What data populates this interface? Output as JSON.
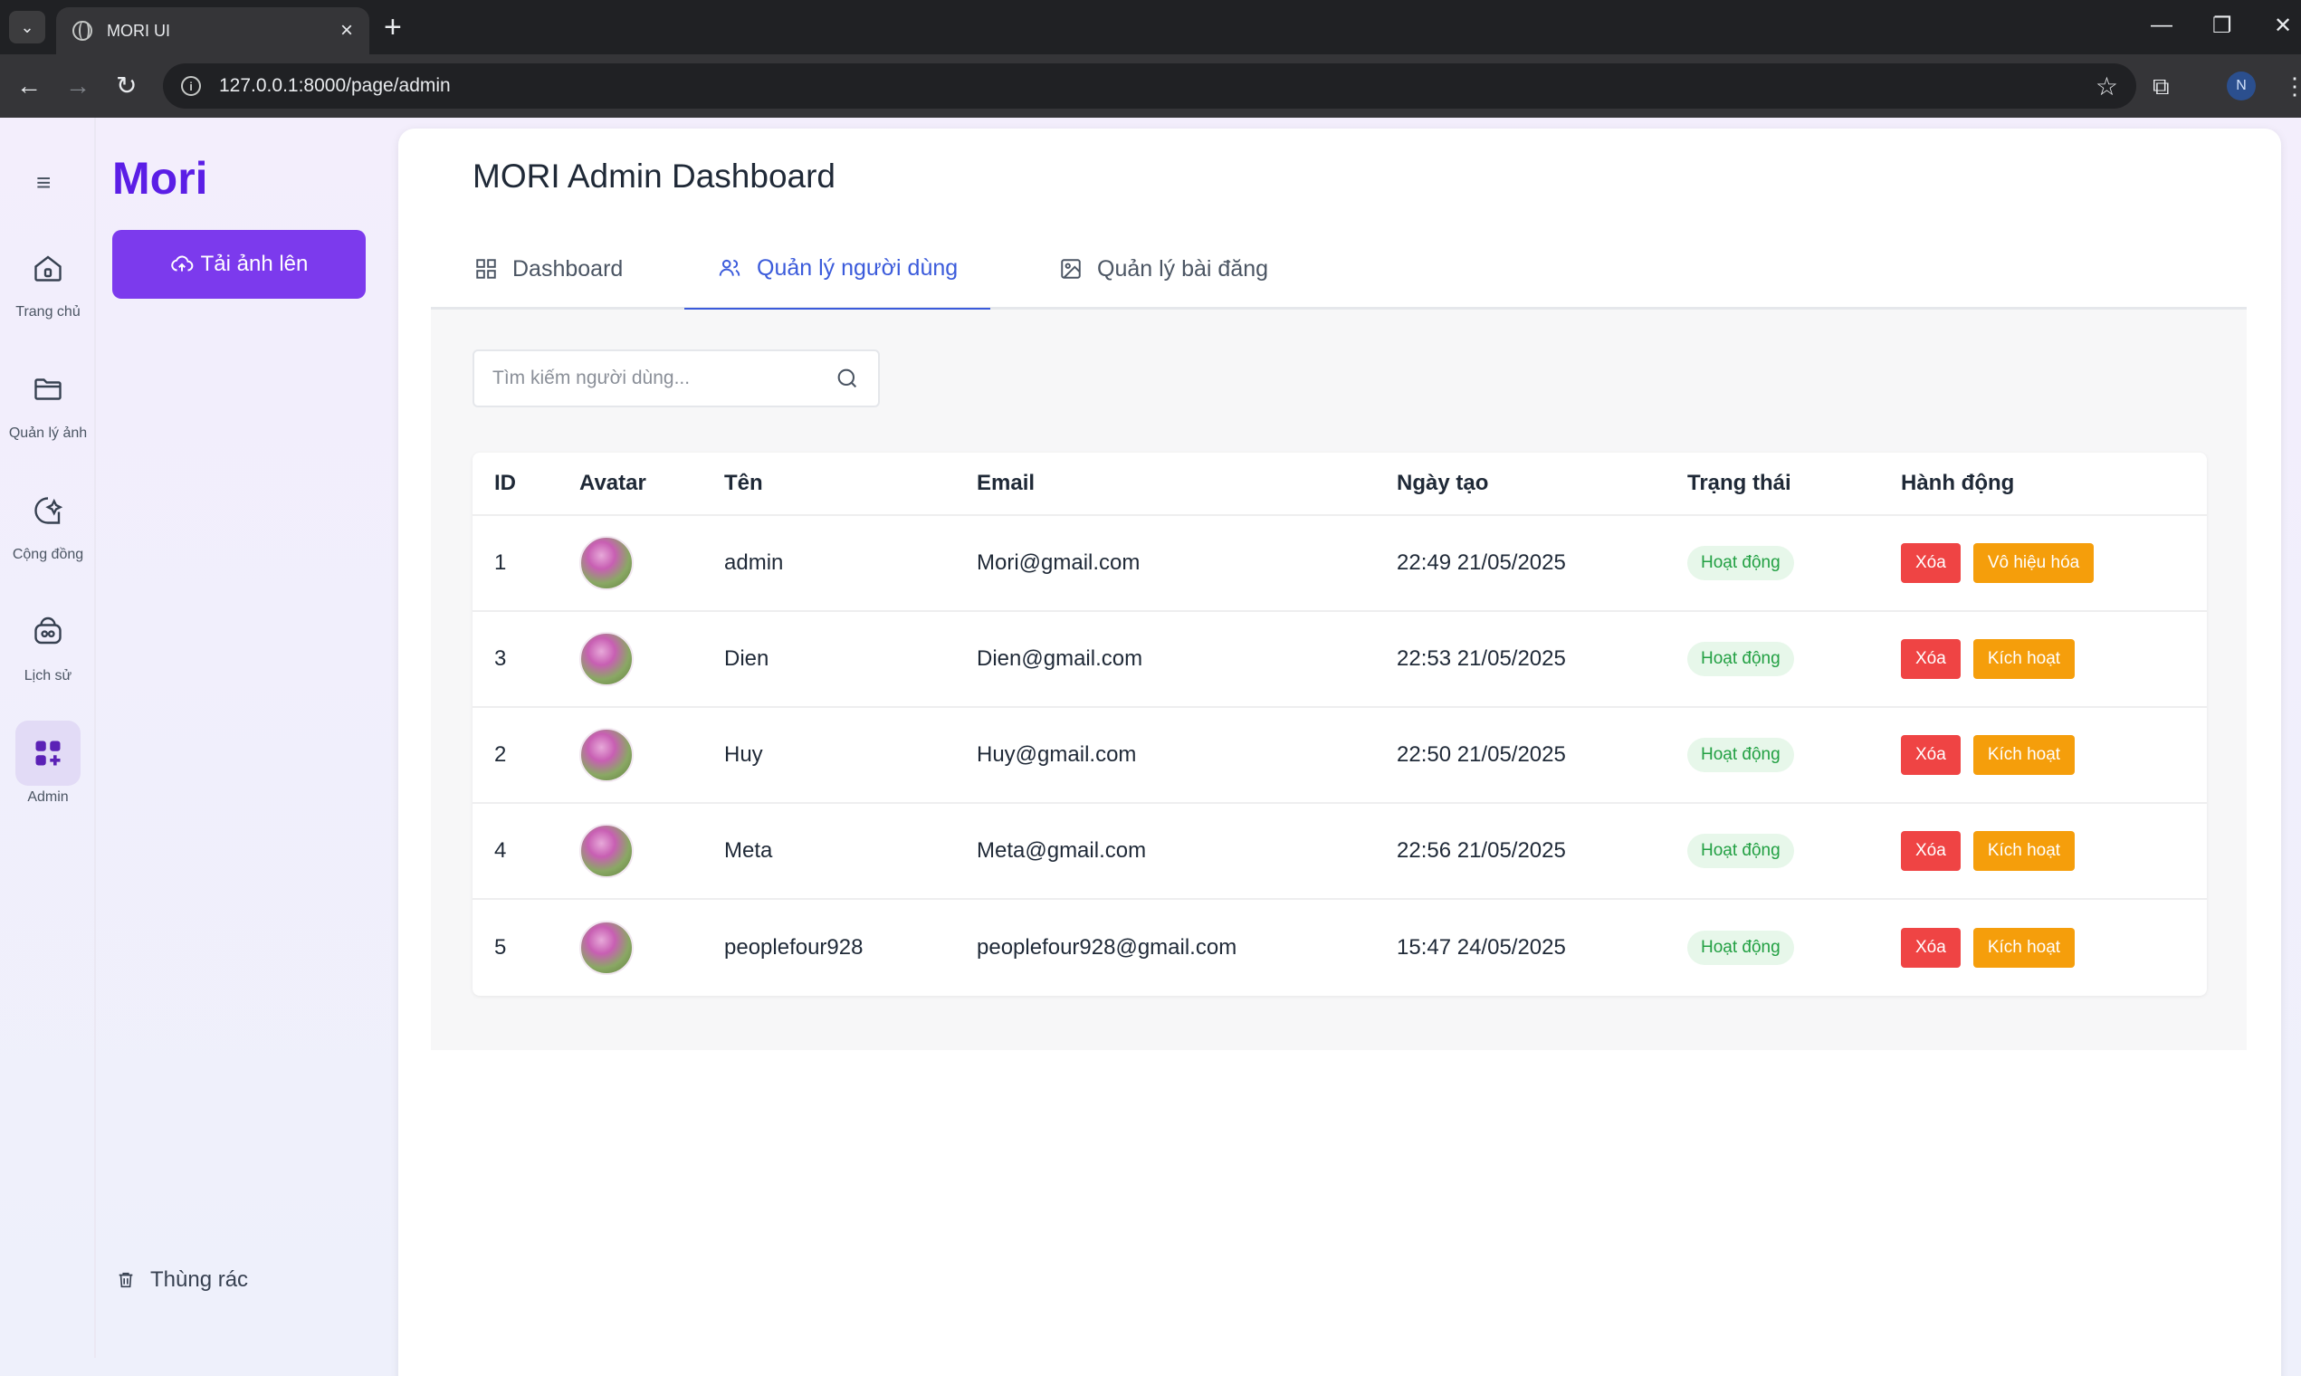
{
  "browser": {
    "tab_title": "MORI UI",
    "url": "127.0.0.1:8000/page/admin",
    "profile_initial": "N"
  },
  "rail": {
    "items": [
      {
        "label": "Trang chủ",
        "icon": "home-icon"
      },
      {
        "label": "Quản lý ảnh",
        "icon": "folder-icon"
      },
      {
        "label": "Cộng đồng",
        "icon": "community-icon"
      },
      {
        "label": "Lịch sử",
        "icon": "history-icon"
      },
      {
        "label": "Admin",
        "icon": "admin-grid-icon"
      }
    ]
  },
  "sidebar": {
    "brand": "Mori",
    "upload_label": "Tải ảnh lên",
    "trash_label": "Thùng rác"
  },
  "main": {
    "title": "MORI Admin Dashboard",
    "tabs": [
      {
        "label": "Dashboard",
        "icon": "grid-icon"
      },
      {
        "label": "Quản lý người dùng",
        "icon": "users-icon"
      },
      {
        "label": "Quản lý bài đăng",
        "icon": "image-icon"
      }
    ],
    "active_tab": "Quản lý người dùng",
    "search_placeholder": "Tìm kiếm người dùng..."
  },
  "table": {
    "headers": [
      "ID",
      "Avatar",
      "Tên",
      "Email",
      "Ngày tạo",
      "Trạng thái",
      "Hành động"
    ],
    "rows": [
      {
        "id": "1",
        "name": "admin",
        "email": "Mori@gmail.com",
        "created": "22:49 21/05/2025",
        "status": "Hoạt động",
        "delete": "Xóa",
        "toggle": "Vô hiệu hóa"
      },
      {
        "id": "3",
        "name": "Dien",
        "email": "Dien@gmail.com",
        "created": "22:53 21/05/2025",
        "status": "Hoạt động",
        "delete": "Xóa",
        "toggle": "Kích hoạt"
      },
      {
        "id": "2",
        "name": "Huy",
        "email": "Huy@gmail.com",
        "created": "22:50 21/05/2025",
        "status": "Hoạt động",
        "delete": "Xóa",
        "toggle": "Kích hoạt"
      },
      {
        "id": "4",
        "name": "Meta",
        "email": "Meta@gmail.com",
        "created": "22:56 21/05/2025",
        "status": "Hoạt động",
        "delete": "Xóa",
        "toggle": "Kích hoạt"
      },
      {
        "id": "5",
        "name": "peoplefour928",
        "email": "peoplefour928@gmail.com",
        "created": "15:47 24/05/2025",
        "status": "Hoạt động",
        "delete": "Xóa",
        "toggle": "Kích hoạt"
      }
    ]
  },
  "colors": {
    "accent": "#7c3aed",
    "brand": "#5b1ee6",
    "active_tab": "#3b5bdb",
    "danger": "#ef4444",
    "warning": "#f59e0b",
    "success": "#22a043"
  }
}
